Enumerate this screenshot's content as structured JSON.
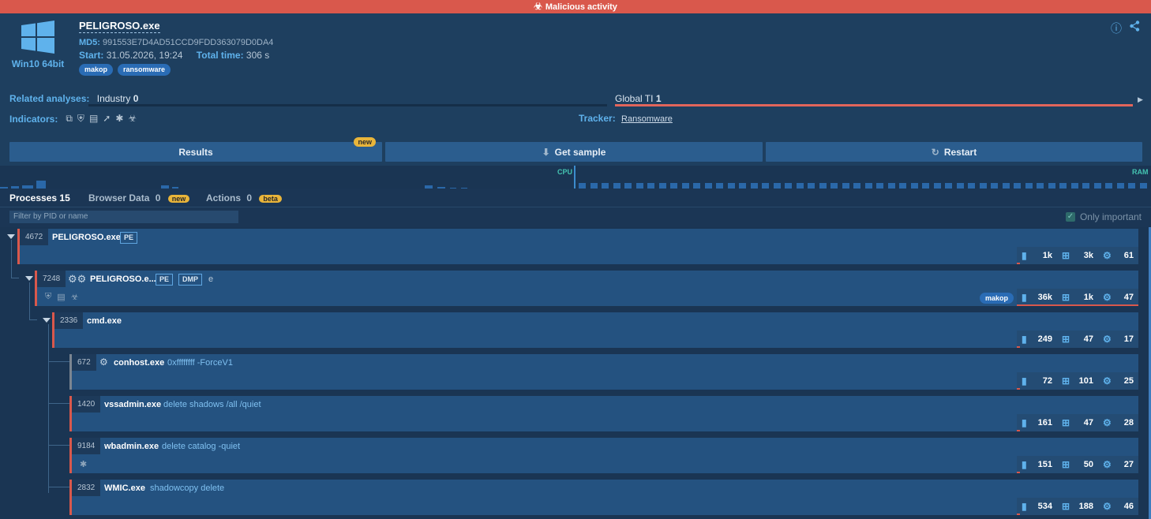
{
  "banner": {
    "label": "Malicious activity",
    "color": "#d9584c"
  },
  "header": {
    "os": "Win10 64bit",
    "filename": "PELIGROSO.exe",
    "md5_label": "MD5:",
    "md5": "991553E7D4AD51CCD9FDD363079D0DA4",
    "start_label": "Start:",
    "start": "31.05.2026, 19:24",
    "total_label": "Total time:",
    "total": "306 s",
    "tags": [
      "makop",
      "ransomware"
    ]
  },
  "related": {
    "label": "Related analyses:",
    "industry_label": "Industry",
    "industry_count": "0",
    "global_label": "Global TI",
    "global_count": "1"
  },
  "indicators": {
    "label": "Indicators:"
  },
  "tracker": {
    "label": "Tracker:",
    "value": "Ransomware"
  },
  "buttons": {
    "results": "Results",
    "results_badge": "new",
    "get_sample": "Get sample",
    "restart": "Restart"
  },
  "graph": {
    "cpu": "CPU",
    "ram": "RAM"
  },
  "tabs": {
    "processes": "Processes",
    "processes_count": "15",
    "browser": "Browser Data",
    "browser_count": "0",
    "browser_badge": "new",
    "actions": "Actions",
    "actions_count": "0",
    "actions_badge": "beta"
  },
  "filter": {
    "placeholder": "Filter by PID or name",
    "only_important": "Only important"
  },
  "processes": [
    {
      "pid": "4672",
      "name": "PELIGROSO.exe",
      "badges": [
        "PE"
      ],
      "cmd": "",
      "files": "1k",
      "reg": "3k",
      "mod": "61"
    },
    {
      "pid": "7248",
      "name": "PELIGROSO.e...",
      "badges": [
        "PE",
        "DMP"
      ],
      "cmd": "e",
      "tag": "makop",
      "files": "36k",
      "reg": "1k",
      "mod": "47"
    },
    {
      "pid": "2336",
      "name": "cmd.exe",
      "badges": [],
      "cmd": "",
      "files": "249",
      "reg": "47",
      "mod": "17"
    },
    {
      "pid": "672",
      "name": "conhost.exe",
      "badges": [],
      "cmd": "0xffffffff -ForceV1",
      "files": "72",
      "reg": "101",
      "mod": "25"
    },
    {
      "pid": "1420",
      "name": "vssadmin.exe",
      "badges": [],
      "cmd": "delete shadows /all /quiet",
      "files": "161",
      "reg": "47",
      "mod": "28"
    },
    {
      "pid": "9184",
      "name": "wbadmin.exe",
      "badges": [],
      "cmd": "delete catalog -quiet",
      "files": "151",
      "reg": "50",
      "mod": "27"
    },
    {
      "pid": "2832",
      "name": "WMIC.exe",
      "badges": [],
      "cmd": "shadowcopy delete",
      "files": "534",
      "reg": "188",
      "mod": "46"
    }
  ]
}
